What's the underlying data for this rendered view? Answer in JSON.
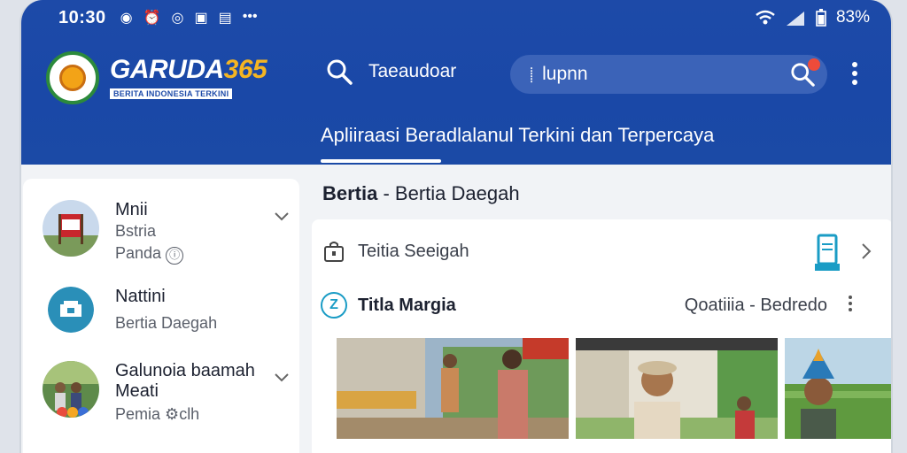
{
  "status_bar": {
    "time": "10:30",
    "battery": "83%"
  },
  "header": {
    "brand_main": "GARUDA",
    "brand_num": "365",
    "brand_tag": "BERITA INDONESIA TERKINI",
    "search_left_text": "Taeaudoar",
    "search_value": "lupnn",
    "tagline": "Apliiraasi Beradlalanul Terkini dan  Terpercaya"
  },
  "sidebar": {
    "items": [
      {
        "title": "Mnii",
        "subtitle": "Bstria",
        "meta": "Panda"
      },
      {
        "title": "Nattini",
        "subtitle": "Bertia Daegah"
      },
      {
        "title": "Galunoia baamah",
        "title2": "Meati",
        "meta": "Pemia",
        "meta2": "clh"
      }
    ]
  },
  "main": {
    "title_bold": "Bertia",
    "title_rest": " - Bertia Daegah",
    "row1_label": "Teitia Seeigah",
    "row2_label": "Titla Margia",
    "row2_right": "Qoatiiia - Bedredo",
    "row2_icon_letter": "Z"
  },
  "colors": {
    "header_blue": "#1d4aa8",
    "accent_orange": "#f5b522",
    "accent_teal": "#1a9cc5",
    "notif_red": "#ee4b3a"
  }
}
